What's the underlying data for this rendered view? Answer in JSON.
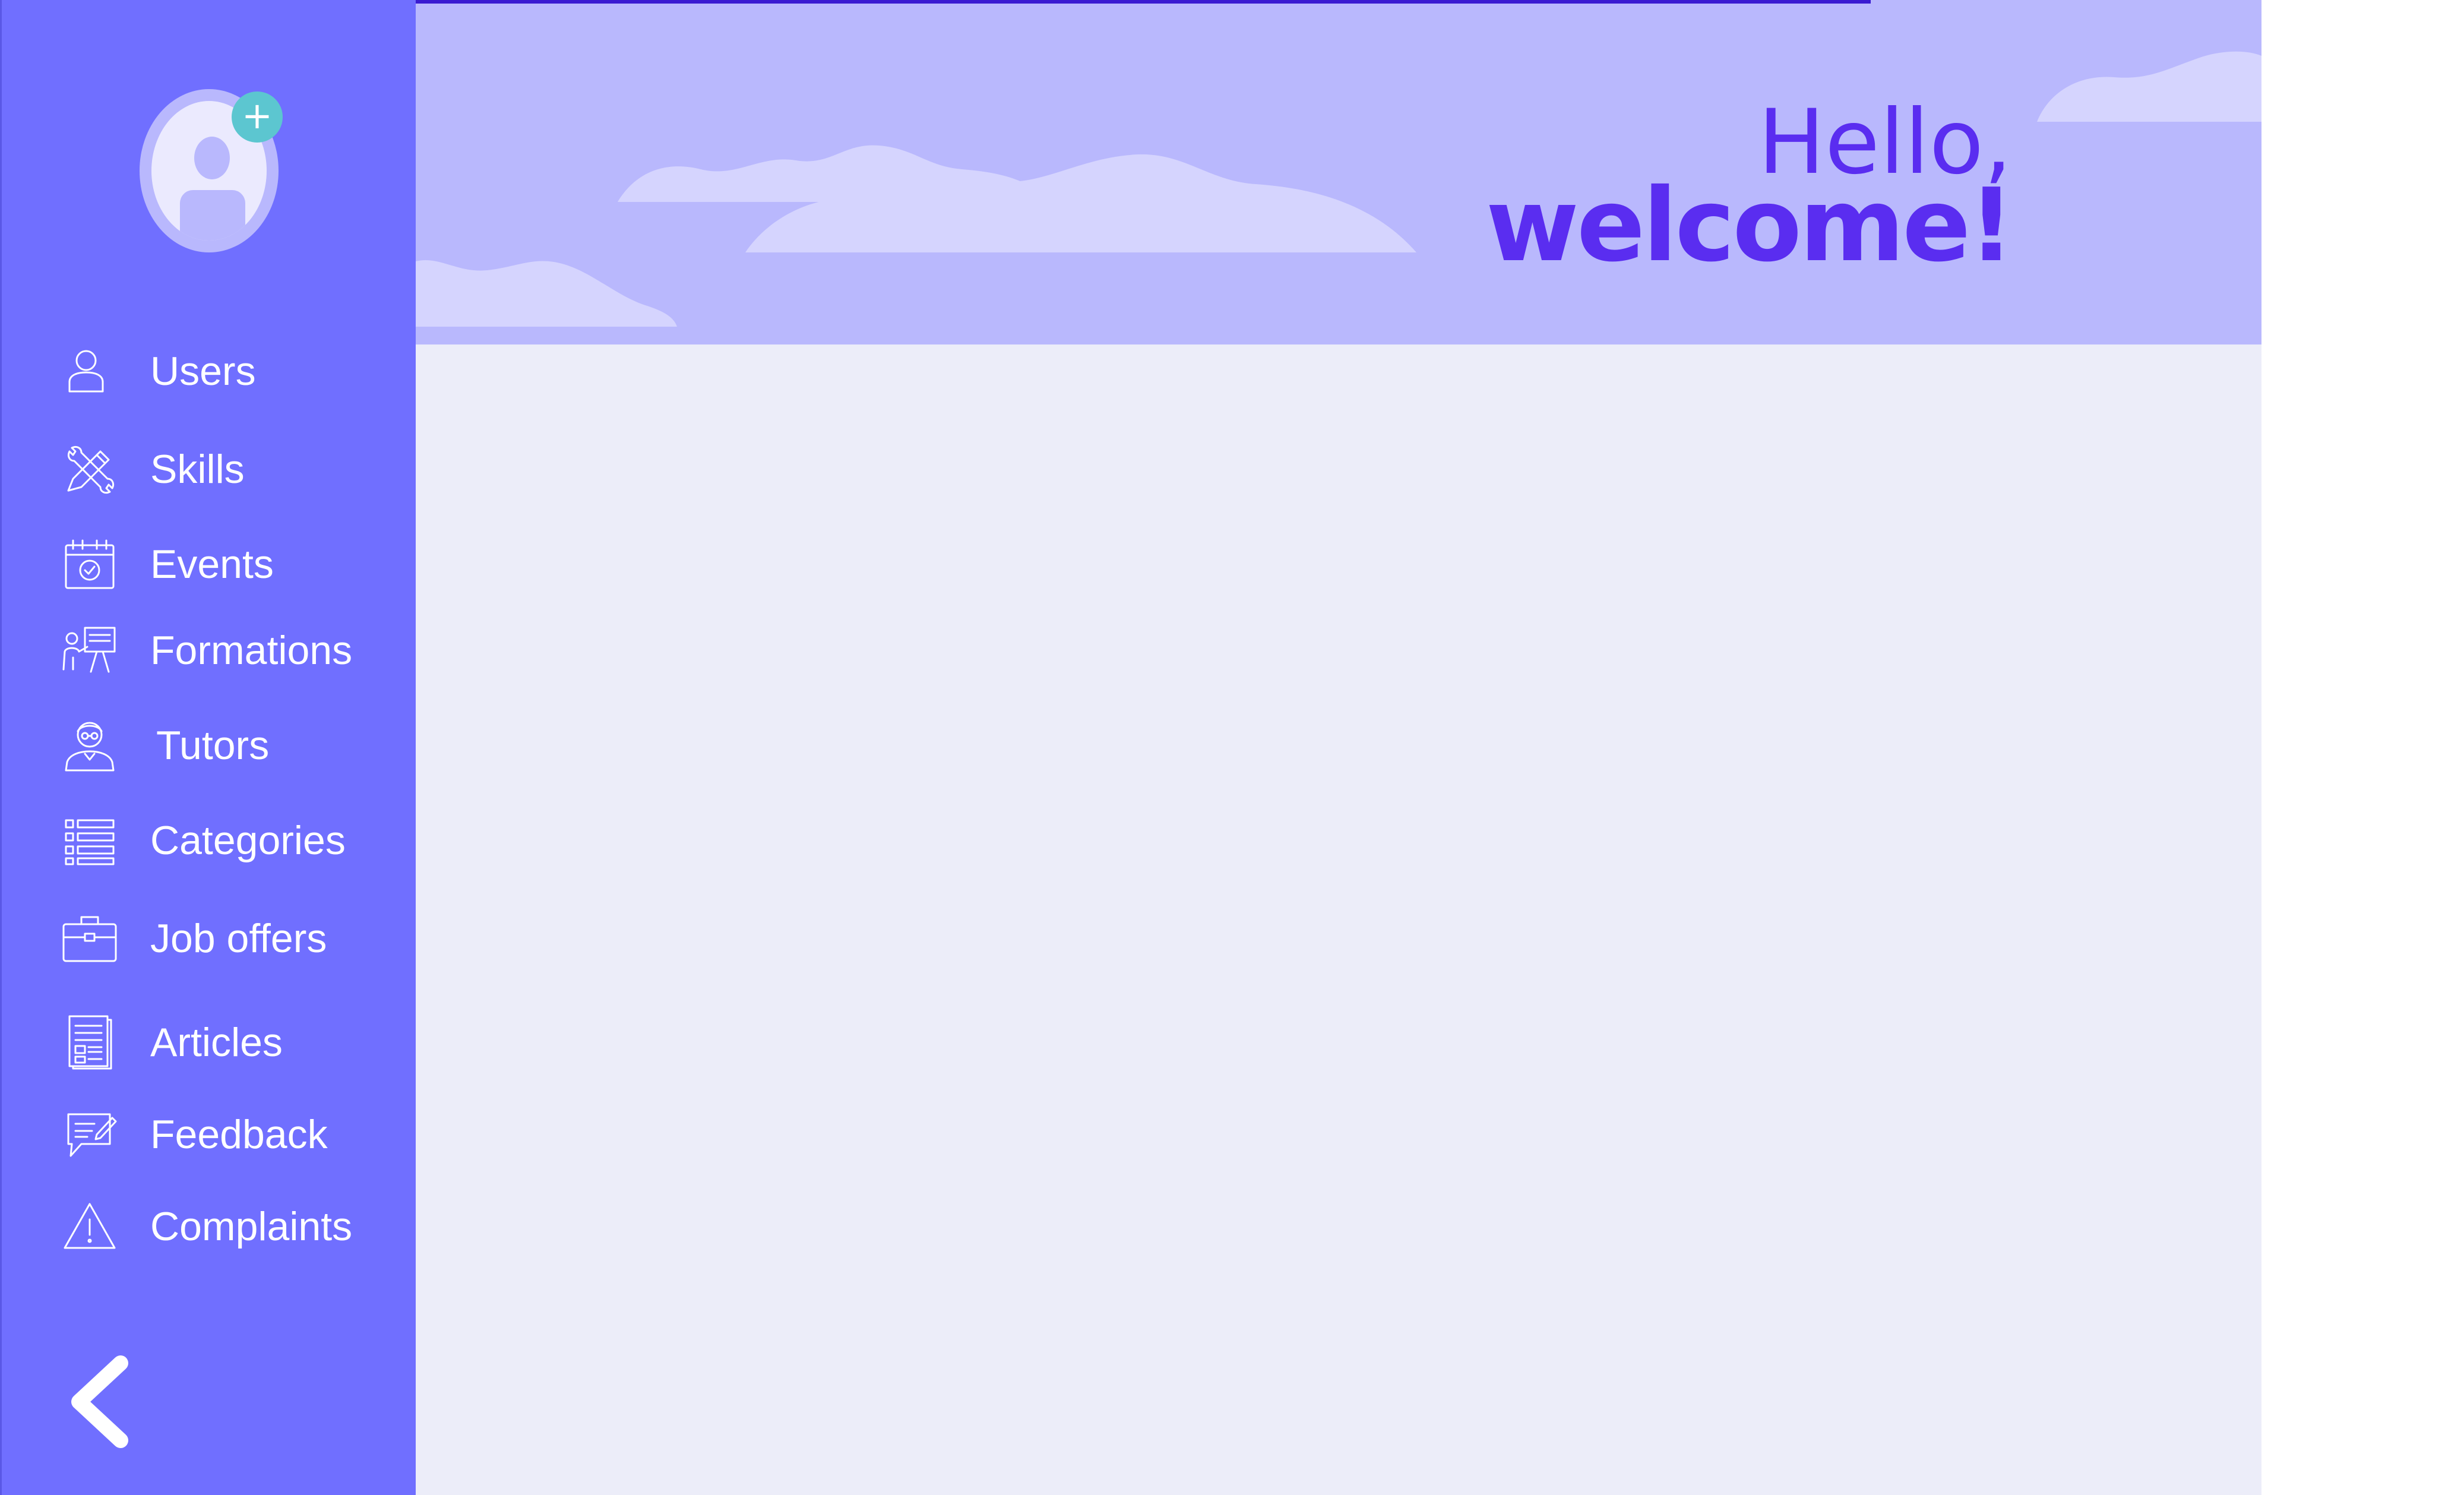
{
  "header": {
    "greeting_line1": "Hello,",
    "greeting_line2": "welcome!"
  },
  "profile": {
    "add_icon": "+"
  },
  "sidebar": {
    "items": [
      {
        "label": "Users",
        "icon": "user-icon"
      },
      {
        "label": "Skills",
        "icon": "tools-icon"
      },
      {
        "label": "Events",
        "icon": "calendar-check-icon"
      },
      {
        "label": "Formations",
        "icon": "presentation-icon"
      },
      {
        "label": "Tutors",
        "icon": "tutor-icon"
      },
      {
        "label": "Categories",
        "icon": "list-icon"
      },
      {
        "label": "Job offers",
        "icon": "briefcase-icon"
      },
      {
        "label": "Articles",
        "icon": "document-icon"
      },
      {
        "label": "Feedback",
        "icon": "chat-edit-icon"
      },
      {
        "label": "Complaints",
        "icon": "warning-icon"
      }
    ],
    "collapse_icon": "chevron-left-icon"
  },
  "colors": {
    "sidebar": "#706fff",
    "header": "#b9b8fd",
    "cloud": "#d5d4fe",
    "accent": "#5a2df0",
    "content_bg": "#ecedf9",
    "avatar_add": "#5cc6d0"
  }
}
